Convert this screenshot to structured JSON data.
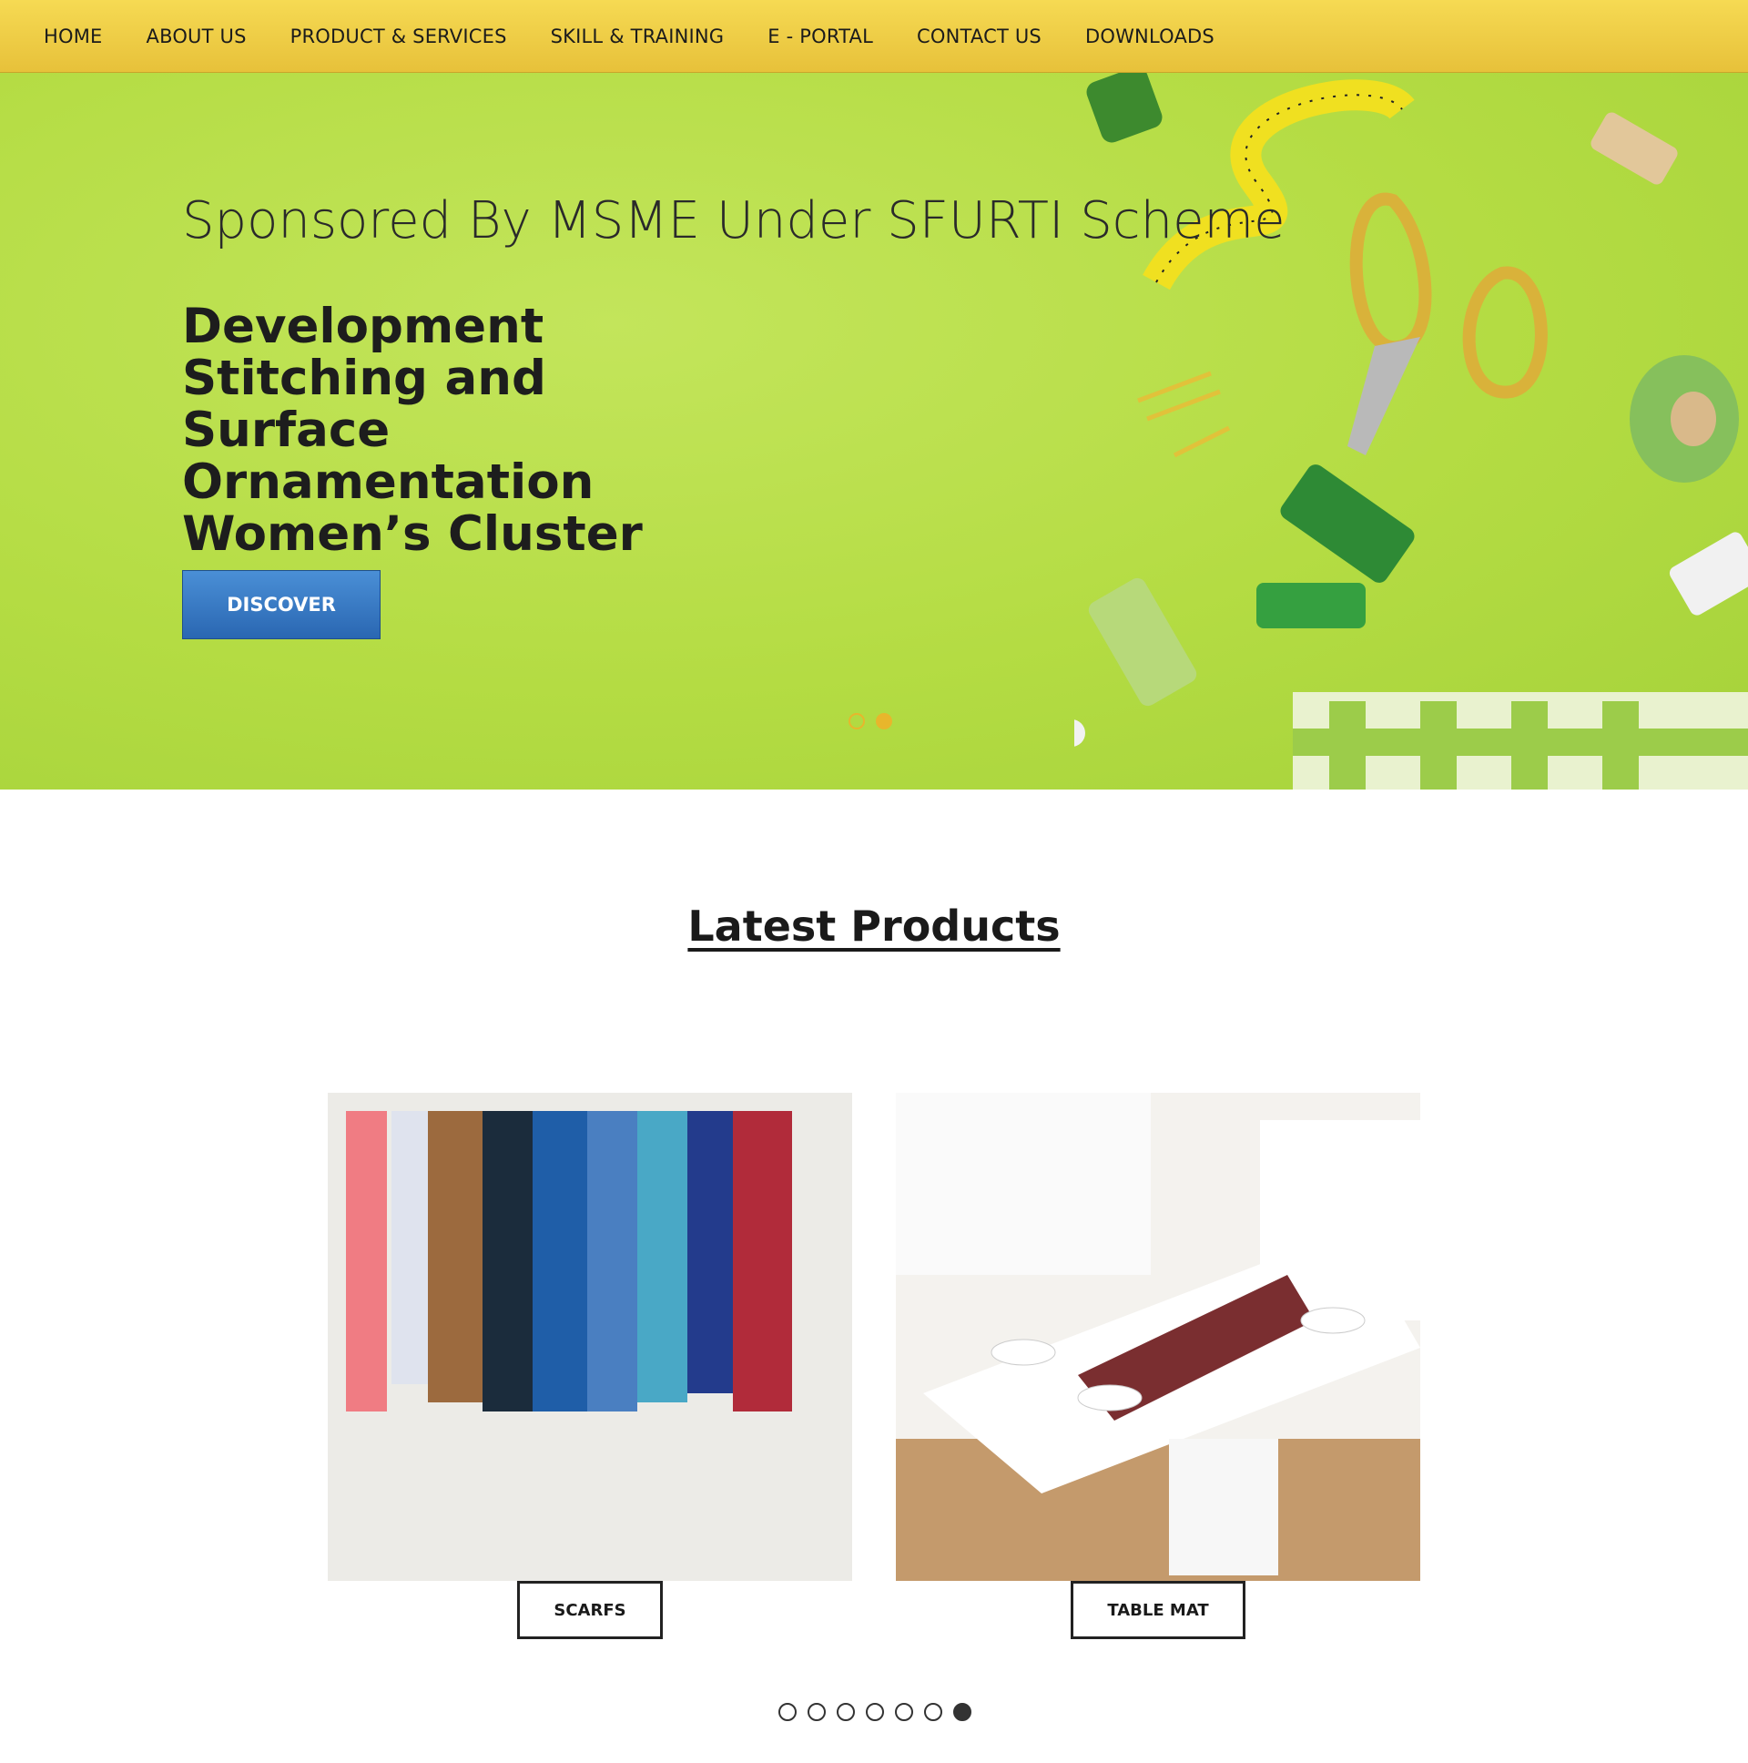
{
  "nav": {
    "items": [
      "HOME",
      "ABOUT US",
      "PRODUCT & SERVICES",
      "SKILL & TRAINING",
      "E - PORTAL",
      "CONTACT US",
      "DOWNLOADS"
    ]
  },
  "hero": {
    "subtitle": "Sponsored By MSME Under SFURTI Scheme",
    "title": "Development Stitching and Surface Ornamentation Women’s Cluster",
    "button": "DISCOVER",
    "slides_total": 2,
    "active_slide": 2,
    "accent_color": "#e8b62c",
    "background_color": "#b4dc43"
  },
  "products": {
    "heading": "Latest Products",
    "items": [
      {
        "label": "SCARFS",
        "icon": "scarfs-photo"
      },
      {
        "label": "TABLE MAT",
        "icon": "table-mat-photo"
      }
    ],
    "pages_total": 7,
    "active_page": 7
  },
  "colors": {
    "nav": "#f0cf46",
    "button": "#3a7cc6"
  }
}
